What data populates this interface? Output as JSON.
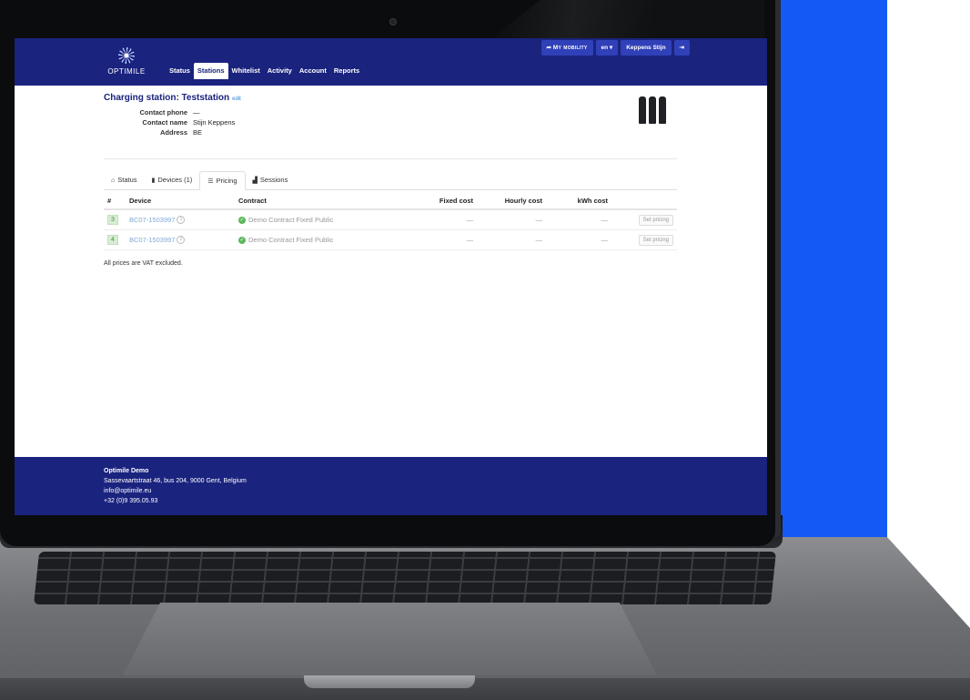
{
  "nav": {
    "logo_text": "OPTIMILE",
    "tabs": [
      "Status",
      "Stations",
      "Whitelist",
      "Activity",
      "Account",
      "Reports"
    ],
    "active_tab": "Stations",
    "my_mobility": "My mobility",
    "language": "en",
    "user": "Keppens Stijn"
  },
  "station": {
    "title": "Charging station: Teststation",
    "edit_label": "edit",
    "fields": [
      {
        "label": "Contact phone",
        "value": "—"
      },
      {
        "label": "Contact name",
        "value": "Stijn Keppens"
      },
      {
        "label": "Address",
        "value": "BE"
      }
    ]
  },
  "tabs": [
    {
      "icon": "home-icon",
      "label": "Status"
    },
    {
      "icon": "device-icon",
      "label": "Devices (1)"
    },
    {
      "icon": "list-icon",
      "label": "Pricing"
    },
    {
      "icon": "chart-icon",
      "label": "Sessions"
    }
  ],
  "active_tab": "Pricing",
  "table": {
    "headers": [
      "#",
      "Device",
      "Contract",
      "Fixed cost",
      "Hourly cost",
      "kWh cost",
      ""
    ],
    "rows": [
      {
        "num": "3",
        "device": "BC07-1503997",
        "connector": "1",
        "contract": "Demo Contract Fixed Public",
        "fixed": "—",
        "hourly": "—",
        "kwh": "—",
        "action": "Set pricing"
      },
      {
        "num": "4",
        "device": "BC07-1503997",
        "connector": "2",
        "contract": "Demo Contract Fixed Public",
        "fixed": "—",
        "hourly": "—",
        "kwh": "—",
        "action": "Set pricing"
      }
    ]
  },
  "vat_note": "All prices are VAT excluded.",
  "footer": {
    "company": "Optimile Demo",
    "address": "Sassevaartstraat 46, bus 204, 9000 Gent, Belgium",
    "email": "info@optimile.eu",
    "phone": "+32 (0)9 395.05.93"
  },
  "colors": {
    "background_blue": "#1459f5",
    "nav_navy": "#1a237e",
    "link_blue": "#2f7ed8",
    "status_green": "#5cb85c"
  }
}
